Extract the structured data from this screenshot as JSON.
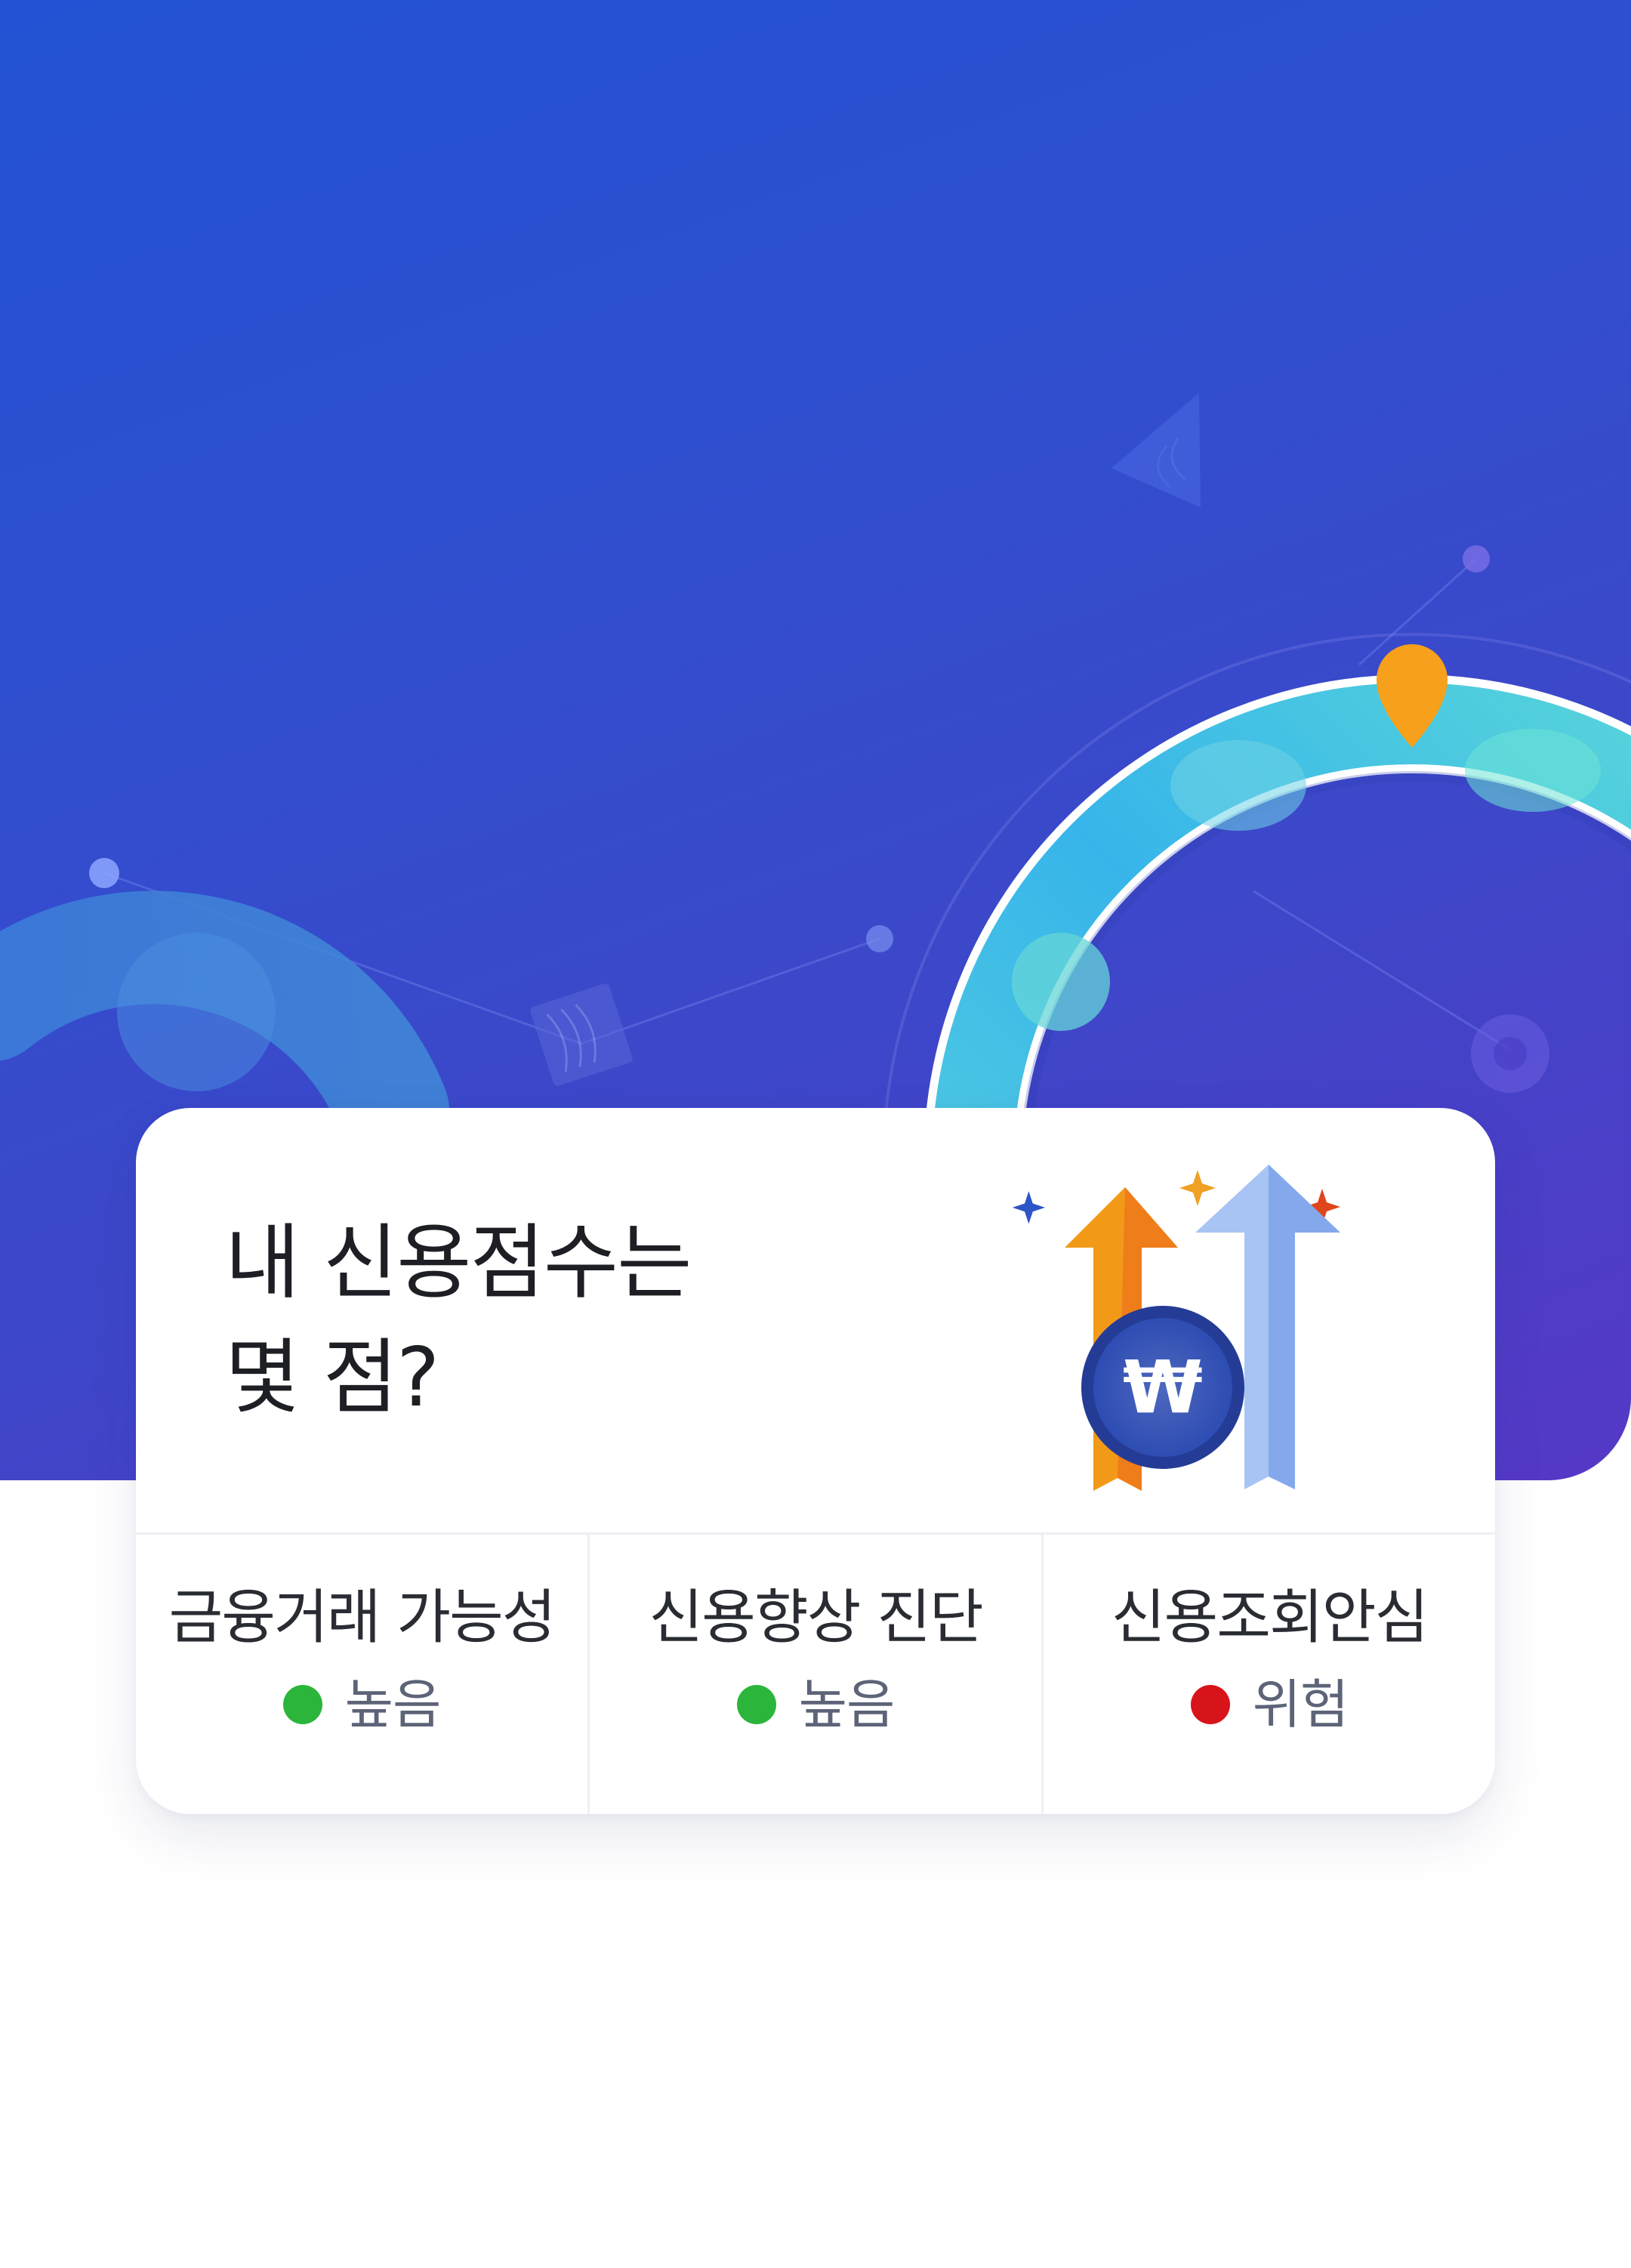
{
  "colors": {
    "brand_blue": "#2252d3",
    "gauge_cyan": "#4fc9df",
    "marker_orange": "#f7a01b",
    "status_high": "#2cb53b",
    "status_danger": "#d8141b",
    "headline_highlight": "#b7cdf6"
  },
  "hero": {
    "decorations": [
      "gauge-arc",
      "score-marker-pin",
      "triangle-shape",
      "square-shape",
      "node-lines"
    ]
  },
  "card": {
    "headline": {
      "prefix": "내 ",
      "highlight": "신용점수",
      "suffix": "는",
      "line2": "몇 점?"
    },
    "illustration": {
      "icon": "rising-arrows-won-coin-icon",
      "coin_symbol": "₩"
    },
    "stats": [
      {
        "label": "금융거래 가능성",
        "status": "높음",
        "status_color": "#2cb53b"
      },
      {
        "label": "신용향상 진단",
        "status": "높음",
        "status_color": "#2cb53b"
      },
      {
        "label": "신용조회안심",
        "status": "위험",
        "status_color": "#d8141b"
      }
    ]
  }
}
